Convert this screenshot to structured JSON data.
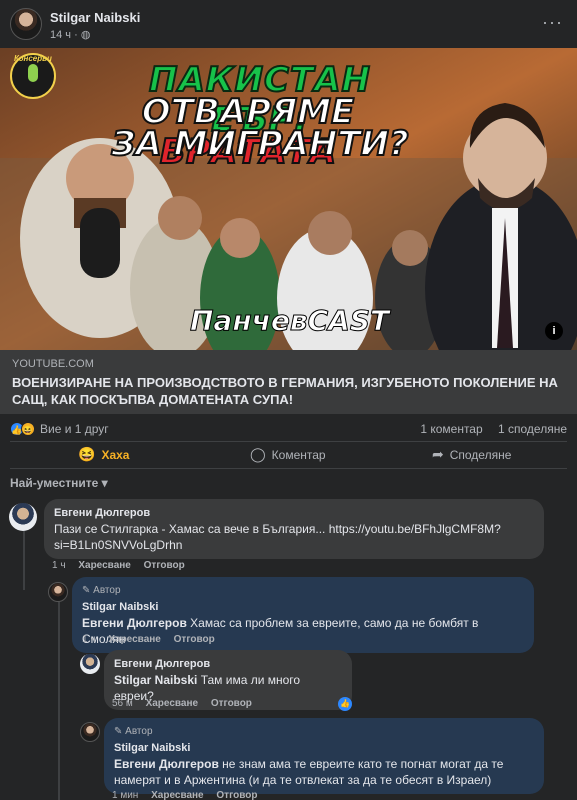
{
  "post": {
    "author": "Stilgar Naibski",
    "time": "14 ч · ",
    "privacy_icon": "globe-icon",
    "more_label": "···"
  },
  "thumbnail": {
    "badge": "Консерви",
    "line1": "ПАКИСТАН ЕЪР:",
    "line2_a": "ОТВАРЯМЕ ",
    "line2_b": "ВРАТАТА",
    "line3": "ЗА МИГРАНТИ?",
    "cast": "ПанчевCAST",
    "info_label": "i",
    "colors": {
      "green": "#17c24a",
      "red": "#e0242c"
    }
  },
  "link": {
    "domain": "YOUTUBE.COM",
    "title": "ВОЕНИЗИРАНЕ НА ПРОИЗВОДСТВОТО В ГЕРМАНИЯ, ИЗГУБЕНОТО ПОКОЛЕНИЕ НА САЩ, КАК ПОСКЪПВА ДОМАТЕНАТА СУПА!"
  },
  "stats": {
    "reactions_text": "Вие и 1 друг",
    "comments": "1 коментар",
    "shares": "1 споделяне"
  },
  "actions": {
    "haha": "Хаха",
    "comment": "Коментар",
    "share": "Споделяне"
  },
  "sort_label": "Най-уместните ▾",
  "comments": [
    {
      "name": "Евгени Дюлгеров",
      "text": "Пази се Стилгарка - Хамас са вече в България... https://youtu.be/BFhJlgCMF8M?si=B1Ln0SNVVoLgDrhn",
      "time": "1 ч",
      "like": "Харесване",
      "reply": "Отговор"
    },
    {
      "tag": "Автор",
      "name": "Stilgar Naibski",
      "mention": "Евгени Дюлгеров",
      "text": " Хамас са проблем за евреите, само да не бомбят в Смолян",
      "time": "1 ч",
      "like": "Харесване",
      "reply": "Отговор"
    },
    {
      "name": "Евгени Дюлгеров",
      "mention": "Stilgar Naibski",
      "text": " Там има ли много евреи?",
      "time": "56 м",
      "like": "Харесване",
      "reply": "Отговор"
    },
    {
      "tag": "Автор",
      "name": "Stilgar Naibski",
      "mention": "Евгени Дюлгеров",
      "text": " не знам ама те евреите като те погнат могат да те намерят и в Аржентина (и да те отвлекат за да те обесят в Израел)",
      "time": "1 мин",
      "like": "Харесване",
      "reply": "Отговор"
    }
  ]
}
